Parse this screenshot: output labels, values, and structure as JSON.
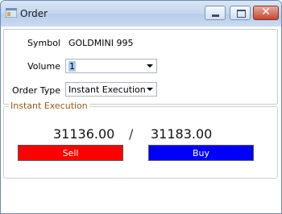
{
  "window": {
    "title": "Order",
    "minimize_label": "",
    "maximize_label": "",
    "close_label": "✕"
  },
  "form": {
    "symbol_label": "Symbol",
    "symbol_value": "GOLDMINI 995",
    "volume_label": "Volume",
    "volume_value": "1",
    "order_type_label": "Order Type",
    "order_type_value": "Instant Execution"
  },
  "instant_execution": {
    "group_title": "Instant Execution",
    "sell_price": "31136.00",
    "separator": "/",
    "buy_price": "31183.00",
    "sell_label": "Sell",
    "buy_label": "Buy"
  },
  "colors": {
    "sell": "#ff0000",
    "buy": "#0000ff",
    "group_title": "#9a5a13"
  }
}
